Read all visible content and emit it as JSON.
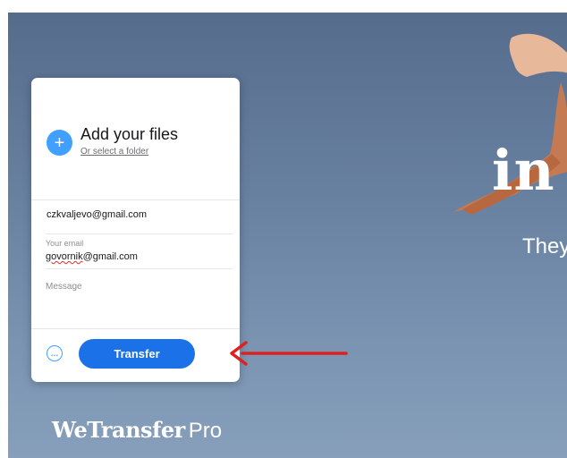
{
  "upload": {
    "add_files_label": "Add your files",
    "add_icon": "+",
    "select_folder_link": "Or select a folder"
  },
  "form": {
    "recipient_value": "czkvaljevo@gmail.com",
    "your_email_label": "Your email",
    "your_email_value_typo": "govornik",
    "your_email_value_rest": "@gmail.com",
    "message_placeholder": "Message"
  },
  "actions": {
    "more_options_icon": "…",
    "transfer_label": "Transfer"
  },
  "hero": {
    "headline_partial": "in",
    "tagline_partial": "They"
  },
  "brand": {
    "name": "WeTransfer",
    "tier": "Pro"
  },
  "annotation": {
    "arrow_color": "#e02020"
  },
  "colors": {
    "accent": "#409fff",
    "primary_button": "#1b72e8"
  }
}
